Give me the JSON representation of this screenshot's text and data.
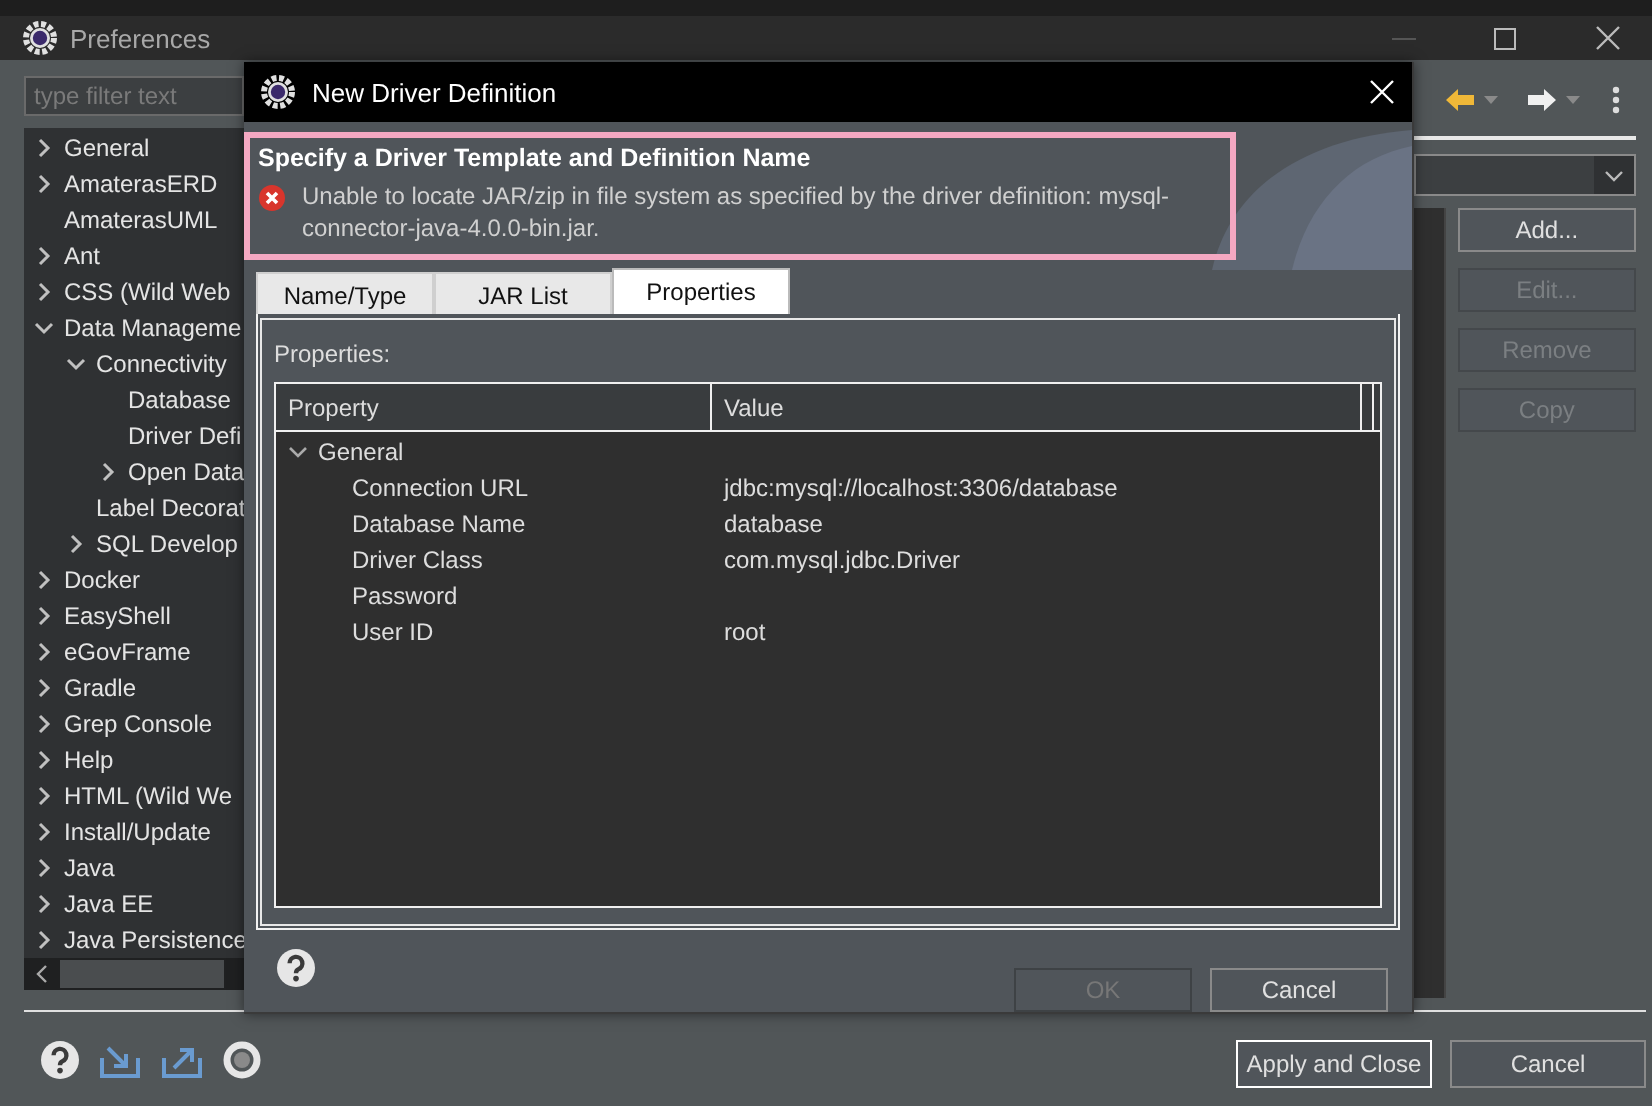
{
  "preferences": {
    "title": "Preferences",
    "filter": {
      "placeholder": "type filter text"
    },
    "tree": [
      {
        "label": "General",
        "kind": "folder",
        "expanded": false
      },
      {
        "label": "AmaterasERD",
        "kind": "folder",
        "expanded": false
      },
      {
        "label": "AmaterasUML",
        "kind": "leaf"
      },
      {
        "label": "Ant",
        "kind": "folder",
        "expanded": false
      },
      {
        "label": "CSS (Wild Web",
        "kind": "folder",
        "expanded": false
      },
      {
        "label": "Data Manageme",
        "kind": "folder",
        "expanded": true,
        "children": [
          {
            "label": "Connectivity",
            "kind": "folder",
            "expanded": true,
            "children": [
              {
                "label": "Database",
                "kind": "leaf"
              },
              {
                "label": "Driver Defi",
                "kind": "leaf"
              },
              {
                "label": "Open Data",
                "kind": "folder",
                "expanded": false
              }
            ]
          },
          {
            "label": "Label Decorat",
            "kind": "leaf"
          },
          {
            "label": "SQL Develop",
            "kind": "folder",
            "expanded": false
          }
        ]
      },
      {
        "label": "Docker",
        "kind": "folder",
        "expanded": false
      },
      {
        "label": "EasyShell",
        "kind": "folder",
        "expanded": false
      },
      {
        "label": "eGovFrame",
        "kind": "folder",
        "expanded": false
      },
      {
        "label": "Gradle",
        "kind": "folder",
        "expanded": false
      },
      {
        "label": "Grep Console",
        "kind": "folder",
        "expanded": false
      },
      {
        "label": "Help",
        "kind": "folder",
        "expanded": false
      },
      {
        "label": "HTML (Wild We",
        "kind": "folder",
        "expanded": false
      },
      {
        "label": "Install/Update",
        "kind": "folder",
        "expanded": false
      },
      {
        "label": "Java",
        "kind": "folder",
        "expanded": false
      },
      {
        "label": "Java EE",
        "kind": "folder",
        "expanded": false
      },
      {
        "label": "Java Persistence",
        "kind": "folder",
        "expanded": false
      }
    ],
    "side_buttons": [
      {
        "label": "Add...",
        "disabled": false
      },
      {
        "label": "Edit...",
        "disabled": true
      },
      {
        "label": "Remove",
        "disabled": true
      },
      {
        "label": "Copy",
        "disabled": true
      }
    ],
    "footer_buttons": [
      {
        "label": "Apply and Close",
        "default": true
      },
      {
        "label": "Cancel",
        "default": false
      }
    ]
  },
  "dialog": {
    "title": "New Driver Definition",
    "header": {
      "title": "Specify a Driver Template and Definition Name",
      "message": "Unable to locate JAR/zip in file system as specified by the driver definition: mysql-connector-java-4.0.0-bin.jar."
    },
    "tabs": [
      {
        "label": "Name/Type",
        "selected": false
      },
      {
        "label": "JAR List",
        "selected": false
      },
      {
        "label": "Properties",
        "selected": true
      }
    ],
    "section_label": "Properties:",
    "table": {
      "columns": [
        "Property",
        "Value"
      ],
      "rows": [
        {
          "label": "General",
          "expanded": true,
          "children": [
            {
              "property": "Connection URL",
              "value": "jdbc:mysql://localhost:3306/database"
            },
            {
              "property": "Database Name",
              "value": "database"
            },
            {
              "property": "Driver Class",
              "value": "com.mysql.jdbc.Driver"
            },
            {
              "property": "Password"
            },
            {
              "property": "User ID",
              "value": "root"
            }
          ]
        }
      ]
    },
    "buttons": [
      {
        "label": "OK",
        "disabled": true
      },
      {
        "label": "Cancel",
        "disabled": false
      }
    ]
  }
}
